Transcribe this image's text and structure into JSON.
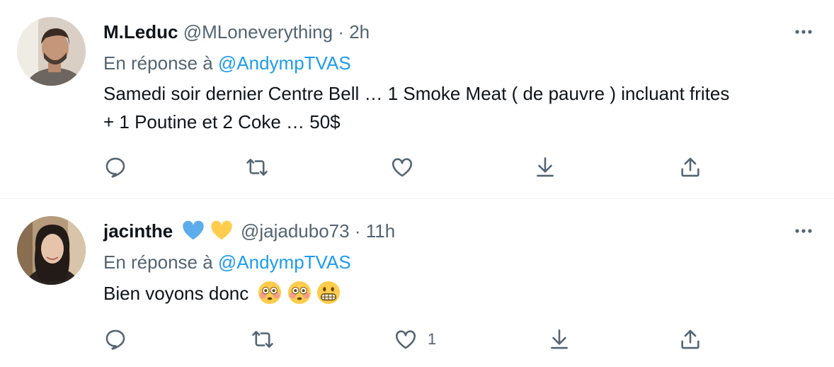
{
  "tweets": [
    {
      "name": "M.Leduc",
      "handle": "@MLoneverything",
      "separator": "·",
      "time": "2h",
      "reply_prefix": "En réponse à",
      "reply_to": "@AndympTVAS",
      "text_line1": "Samedi soir dernier Centre Bell … 1 Smoke Meat ( de pauvre ) incluant frites",
      "text_line2": "+ 1 Poutine et 2 Coke … 50$",
      "like_count": ""
    },
    {
      "name": "jacinthe",
      "handle": "@jajadubo73",
      "separator": "·",
      "time": "11h",
      "reply_prefix": "En réponse à",
      "reply_to": "@AndympTVAS",
      "text_line1": "Bien voyons donc",
      "like_count": "1"
    }
  ],
  "colors": {
    "text": "#0f1419",
    "secondary": "#536471",
    "link": "#1d9bf0",
    "divider": "#eff3f4"
  },
  "icons": [
    "more-icon",
    "reply-icon",
    "retweet-icon",
    "like-icon",
    "bookmark-icon",
    "share-icon",
    "blue-heart-icon",
    "yellow-heart-icon",
    "flushed-face-icon",
    "grimacing-face-icon"
  ]
}
